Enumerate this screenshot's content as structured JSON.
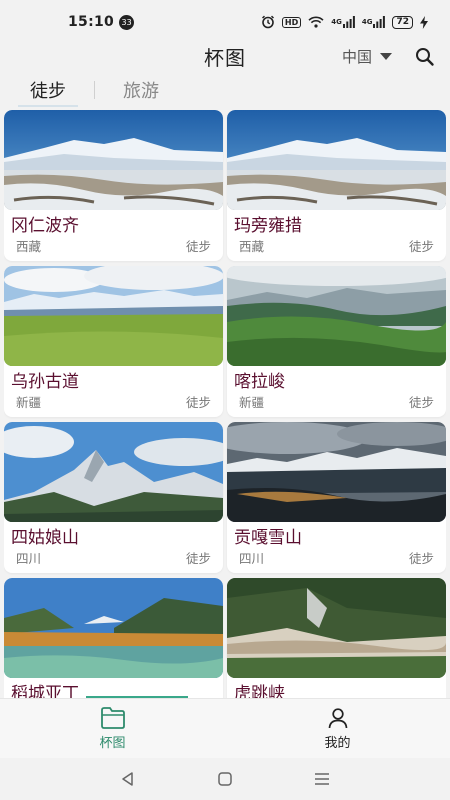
{
  "status_bar": {
    "time": "15:10",
    "notification_count": "33",
    "hd_label": "HD",
    "signal_1": "4G",
    "signal_2": "4G",
    "battery": "72"
  },
  "header": {
    "title": "杯图",
    "region": "中国"
  },
  "tabs": [
    {
      "label": "徒步",
      "active": true
    },
    {
      "label": "旅游",
      "active": false
    }
  ],
  "cards": [
    {
      "title": "冈仁波齐",
      "region": "西藏",
      "category": "徒步",
      "image": "snow-plateau-photo"
    },
    {
      "title": "玛旁雍措",
      "region": "西藏",
      "category": "徒步",
      "image": "snow-plateau-photo"
    },
    {
      "title": "乌孙古道",
      "region": "新疆",
      "category": "徒步",
      "image": "grassland-photo"
    },
    {
      "title": "喀拉峻",
      "region": "新疆",
      "category": "徒步",
      "image": "green-hills-photo"
    },
    {
      "title": "四姑娘山",
      "region": "四川",
      "category": "徒步",
      "image": "snow-peak-photo"
    },
    {
      "title": "贡嘎雪山",
      "region": "四川",
      "category": "徒步",
      "image": "mountain-range-photo"
    },
    {
      "title": "稻城亚丁",
      "region": "",
      "category": "",
      "image": "lake-valley-photo"
    },
    {
      "title": "虎跳峡",
      "region": "",
      "category": "",
      "image": "gorge-photo"
    }
  ],
  "bottom_nav": [
    {
      "label": "杯图",
      "icon": "folder-icon",
      "active": true
    },
    {
      "label": "我的",
      "icon": "user-icon",
      "active": false
    }
  ],
  "colors": {
    "accent": "#2e8b6c",
    "title": "#5a0f2f"
  }
}
